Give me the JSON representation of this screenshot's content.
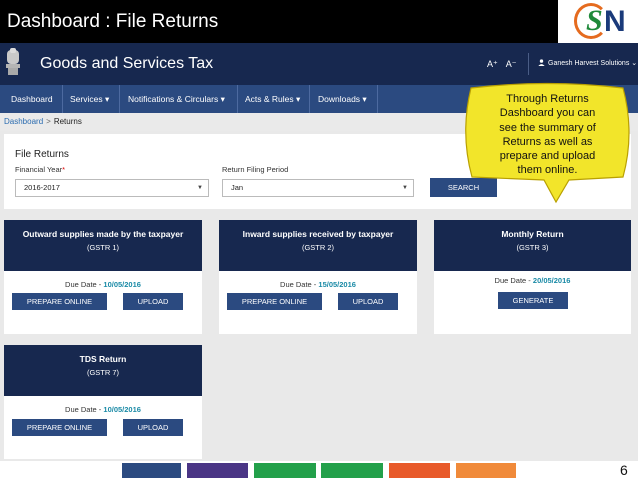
{
  "slide": {
    "title": "Dashboard : File Returns",
    "page_number": "6",
    "logo_alt": "GST"
  },
  "header": {
    "site_title": "Goods and Services Tax",
    "font_increase": "A⁺",
    "font_decrease": "A⁻",
    "user_icon": "user-icon",
    "user_name": "Ganesh Harvest Solutions",
    "user_chevron": "⌄"
  },
  "nav": {
    "items": [
      {
        "label": "Dashboard"
      },
      {
        "label": "Services ▾"
      },
      {
        "label": "Notifications & Circulars ▾"
      },
      {
        "label": "Acts & Rules ▾"
      },
      {
        "label": "Downloads ▾"
      }
    ]
  },
  "breadcrumb": {
    "home": "Dashboard",
    "separator": ">",
    "current": "Returns"
  },
  "file_returns": {
    "title": "File Returns",
    "financial_year_label": "Financial Year",
    "financial_year_required": "*",
    "financial_year_value": "2016-2017",
    "period_label": "Return Filing Period",
    "period_value": "Jan",
    "search_label": "SEARCH"
  },
  "tiles": [
    {
      "title": "Outward supplies made by the taxpayer",
      "form": "(GSTR 1)",
      "due_label": "Due Date -",
      "due_date": "10/05/2016",
      "btn1": "PREPARE ONLINE",
      "btn2": "UPLOAD"
    },
    {
      "title": "Inward supplies received by taxpayer",
      "form": "(GSTR 2)",
      "due_label": "Due Date -",
      "due_date": "15/05/2016",
      "btn1": "PREPARE ONLINE",
      "btn2": "UPLOAD"
    },
    {
      "title": "Monthly Return",
      "form": "(GSTR 3)",
      "due_label": "Due Date -",
      "due_date": "20/05/2016",
      "btn1": "GENERATE"
    },
    {
      "title": "TDS Return",
      "form": "(GSTR 7)",
      "due_label": "Due Date -",
      "due_date": "10/05/2016",
      "btn1": "PREPARE ONLINE",
      "btn2": "UPLOAD"
    }
  ],
  "callout": {
    "line1": "Through Returns",
    "line2": "Dashboard you can",
    "line3": "see the summary of",
    "line4": "Returns as well as",
    "line5": "prepare and upload",
    "line6": "them online."
  },
  "colors": {
    "header_navy": "#17284f",
    "nav_blue": "#2b4a80",
    "due_date_teal": "#1a8aa6",
    "callout_yellow": "#f2e52a",
    "strip_colors": [
      "#2b4a80",
      "#4a3585",
      "#23a04a",
      "#23a04a",
      "#e85a2a",
      "#f08a3a"
    ]
  }
}
